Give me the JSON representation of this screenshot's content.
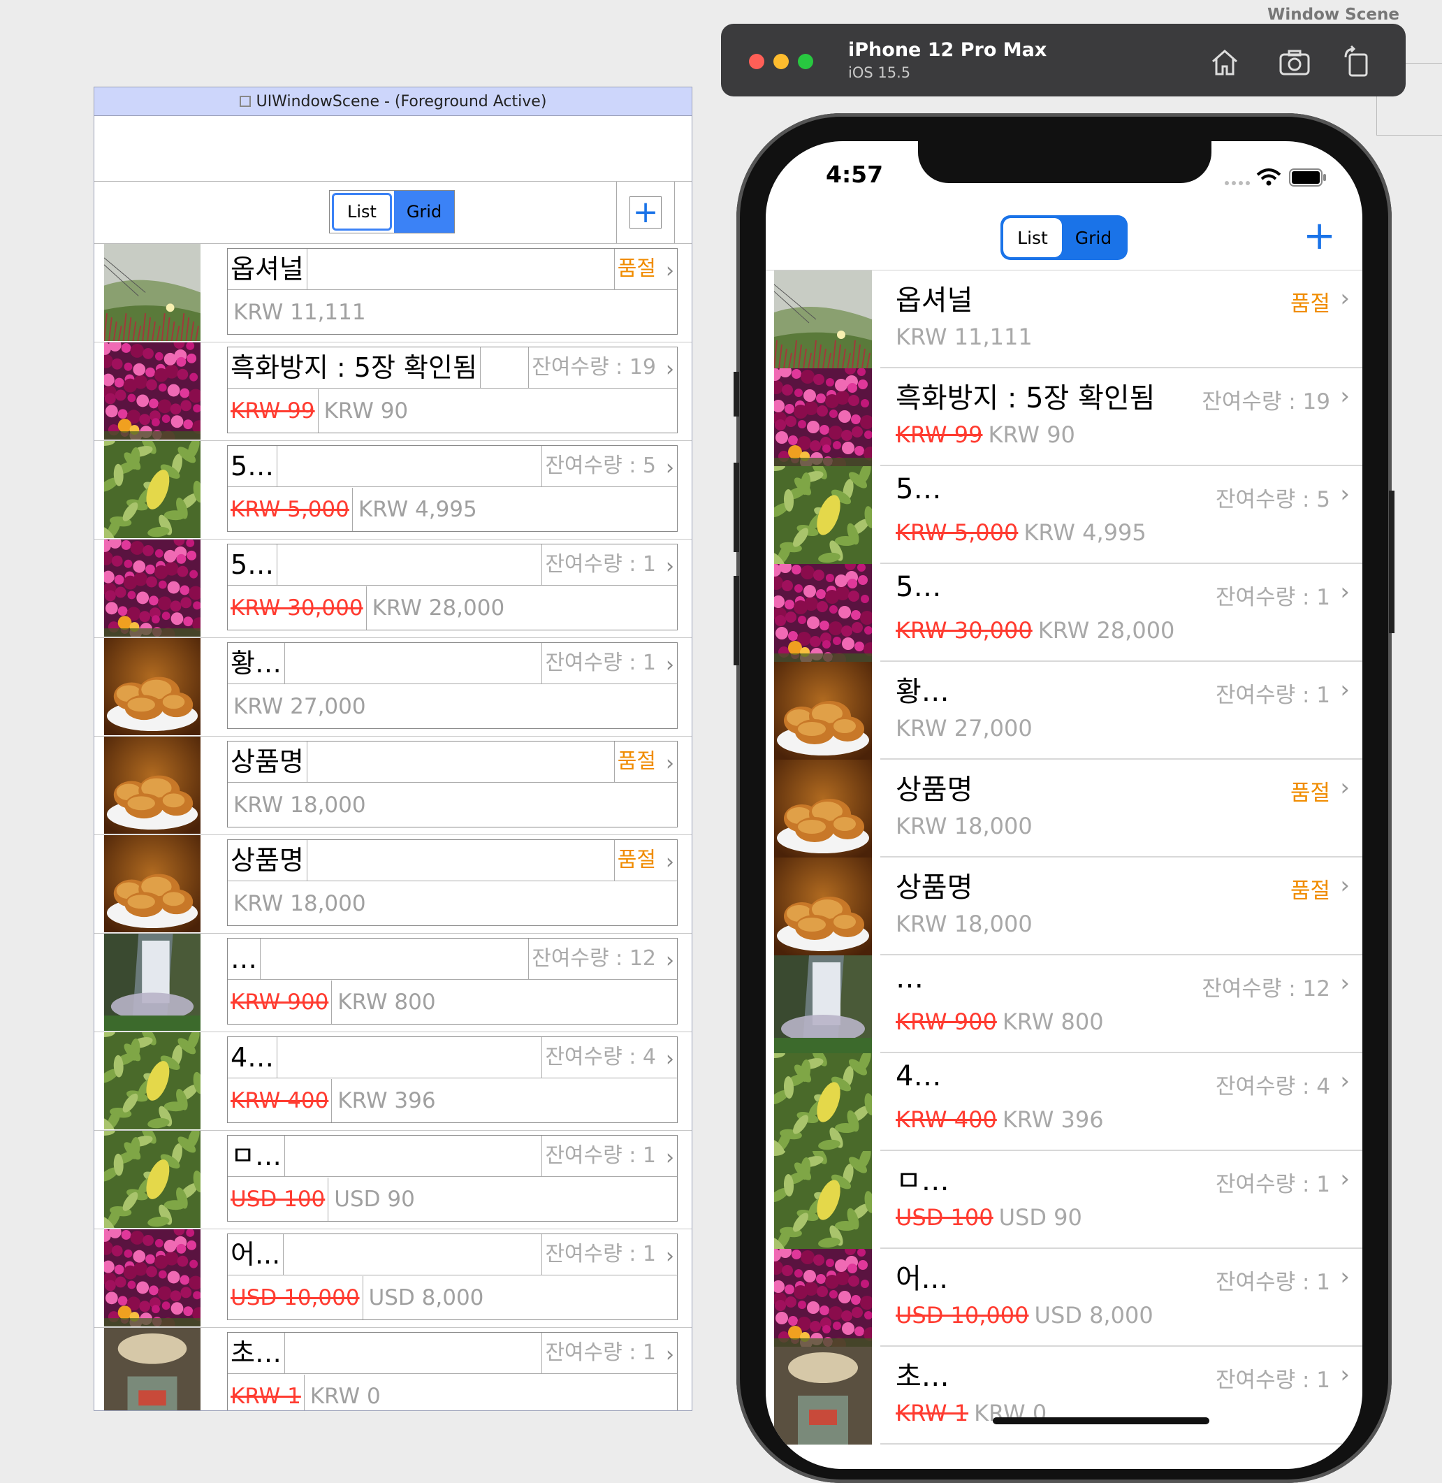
{
  "debug": {
    "title": "UIWindowScene - (Foreground Active)",
    "seg_list": "List",
    "seg_grid": "Grid"
  },
  "simulator": {
    "device": "iPhone 12 Pro Max",
    "os": "iOS 15.5",
    "window_scene_label": "Window Scene",
    "toolbar_icons": [
      "home-icon",
      "screenshot-icon",
      "rotate-icon"
    ],
    "traffic_lights": [
      "#ff5f57",
      "#febc2e",
      "#28c840"
    ]
  },
  "app": {
    "time": "4:57",
    "seg_list": "List",
    "seg_grid": "Grid",
    "add_label": "+",
    "accent": "#1a73e8",
    "sold_color": "#f08c00",
    "sale_color": "#ff3b30",
    "items": [
      {
        "name": "옵셔널",
        "stock": "품절",
        "sold": true,
        "old_price": "",
        "price": "KRW 11,111",
        "image": "hillside-flower"
      },
      {
        "name": "흑화방지 : 5장 확인됨",
        "stock": "잔여수량 : 19",
        "sold": false,
        "old_price": "KRW 99",
        "price": "KRW 90",
        "image": "pink-flowers"
      },
      {
        "name": "5…",
        "stock": "잔여수량 : 5",
        "sold": false,
        "old_price": "KRW 5,000",
        "price": "KRW 4,995",
        "image": "green-leaves"
      },
      {
        "name": "5…",
        "stock": "잔여수량 : 1",
        "sold": false,
        "old_price": "KRW 30,000",
        "price": "KRW 28,000",
        "image": "pink-flowers"
      },
      {
        "name": "황…",
        "stock": "잔여수량 : 1",
        "sold": false,
        "old_price": "",
        "price": "KRW 27,000",
        "image": "fried-chicken"
      },
      {
        "name": "상품명",
        "stock": "품절",
        "sold": true,
        "old_price": "",
        "price": "KRW 18,000",
        "image": "fried-chicken"
      },
      {
        "name": "상품명",
        "stock": "품절",
        "sold": true,
        "old_price": "",
        "price": "KRW 18,000",
        "image": "fried-chicken"
      },
      {
        "name": "…",
        "stock": "잔여수량 : 12",
        "sold": false,
        "old_price": "KRW 900",
        "price": "KRW 800",
        "image": "waterfall"
      },
      {
        "name": "4…",
        "stock": "잔여수량 : 4",
        "sold": false,
        "old_price": "KRW 400",
        "price": "KRW 396",
        "image": "green-leaves"
      },
      {
        "name": "ㅁ…",
        "stock": "잔여수량 : 1",
        "sold": false,
        "old_price": "USD 100",
        "price": "USD 90",
        "image": "green-leaves"
      },
      {
        "name": "어...",
        "stock": "잔여수량 : 1",
        "sold": false,
        "old_price": "USD 10,000",
        "price": "USD 8,000",
        "image": "pink-flowers"
      },
      {
        "name": "초…",
        "stock": "잔여수량 : 1",
        "sold": false,
        "old_price": "KRW 1",
        "price": "KRW 0",
        "image": "person-photo"
      }
    ]
  }
}
